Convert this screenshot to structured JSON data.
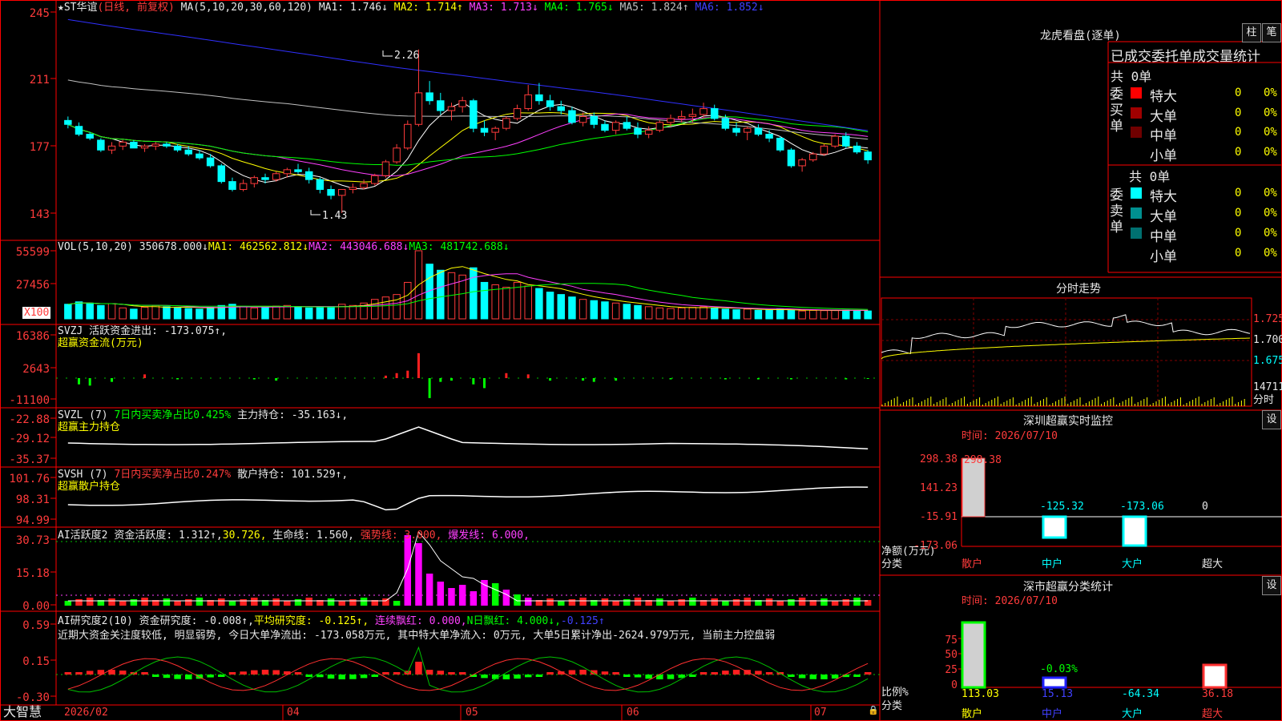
{
  "app_name": "大智慧",
  "colors": {
    "up": "#ff3b3b",
    "down": "#00ffff",
    "grid": "#c00000",
    "frame": "#ff0000"
  },
  "price_panel": {
    "stock_name": "★ST华谊",
    "period": "(日线, 前复权)",
    "ma_prefix": "MA(5,10,20,30,60,120)",
    "ma_values": [
      "MA1: 1.746↓",
      "MA2: 1.714↑",
      "MA3: 1.713↓",
      "MA4: 1.765↓",
      "MA5: 1.824↑",
      "MA6: 1.852↓"
    ],
    "y_ticks": [
      "245",
      "211",
      "177",
      "143"
    ],
    "high_label": "2.26",
    "low_label": "1.43"
  },
  "vol_panel": {
    "title": "VOL(5,10,20)",
    "value": "350678.000↓",
    "ma1": "MA1: 462562.812↓",
    "ma2": "MA2: 443046.688↓",
    "ma3": "MA3: 481742.688↓",
    "y_ticks": [
      "55599",
      "27456"
    ],
    "unit": "X100"
  },
  "svzj_panel": {
    "title": "SVZJ",
    "label": "活跃资金进出: -173.075↑,",
    "subtitle": "超赢资金流(万元)",
    "y_ticks": [
      "16386",
      "2643",
      "-11100"
    ]
  },
  "svzl_panel": {
    "title": "SVZL (7)",
    "ratio": "7日内买卖净占比0.425%",
    "label": "主力持仓: -35.163↓,",
    "subtitle": "超赢主力持仓",
    "y_ticks": [
      "-22.88",
      "-29.12",
      "-35.37"
    ]
  },
  "svsh_panel": {
    "title": "SVSH (7)",
    "ratio": "7日内买卖净占比0.247%",
    "label": "散户持仓: 101.529↑,",
    "subtitle": "超赢散户持仓",
    "y_ticks": [
      "101.76",
      "98.31",
      "94.99"
    ]
  },
  "ai_active_panel": {
    "title": "AI活跃度2",
    "label": "资金活跃度: 1.312↑,",
    "v2": "30.726,",
    "life": "生命线: 1.560,",
    "strong": "强势线: 3.000,",
    "burst": "爆发线: 6.000,",
    "y_ticks": [
      "30.73",
      "15.18",
      "0.00"
    ]
  },
  "ai_research_panel": {
    "title": "AI研究度2(10)",
    "label": "资金研究度: -0.008↑,",
    "avg": "平均研究度: -0.125↑,",
    "cont": "连续飘红: 0.000,",
    "nday": "N日飘红: 4.000↓,",
    "last": "-0.125↑",
    "comment": "近期大资金关注度较低, 明显弱势, 今日大单净流出: -173.058万元, 其中特大单净流入: 0万元, 大单5日累计净出-2624.979万元, 当前主力控盘弱",
    "y_ticks": [
      "0.59",
      "0.15",
      "-0.30"
    ]
  },
  "x_axis": [
    "2026/02",
    "04",
    "05",
    "06",
    "07"
  ],
  "order_panel": {
    "title": "龙虎看盘(逐单)",
    "btn_bar": "柱",
    "btn_pen": "笔",
    "subtitle": "已成交委托单成交量统计",
    "buy": {
      "label": "委买单",
      "total": "共 0单",
      "rows": [
        {
          "name": "特大",
          "count": "0",
          "pct": "0%",
          "color": "#ff0000"
        },
        {
          "name": "大单",
          "count": "0",
          "pct": "0%",
          "color": "#a00000"
        },
        {
          "name": "中单",
          "count": "0",
          "pct": "0%",
          "color": "#700000"
        },
        {
          "name": "小单",
          "count": "0",
          "pct": "0%",
          "color": "#000000"
        }
      ]
    },
    "sell": {
      "label": "委卖单",
      "total": "共 0单",
      "rows": [
        {
          "name": "特大",
          "count": "0",
          "pct": "0%",
          "color": "#00ffff"
        },
        {
          "name": "大单",
          "count": "0",
          "pct": "0%",
          "color": "#009090"
        },
        {
          "name": "中单",
          "count": "0",
          "pct": "0%",
          "color": "#007070"
        },
        {
          "name": "小单",
          "count": "0",
          "pct": "0%",
          "color": "#000000"
        }
      ]
    }
  },
  "intraday_panel": {
    "title": "分时走势",
    "y_ticks": [
      "1.725",
      "1.700",
      "1.675"
    ],
    "vol_label": "14711",
    "vol_unit": "分时"
  },
  "sz_monitor": {
    "title": "深圳超赢实时监控",
    "btn": "设",
    "time": "时间: 2026/07/10",
    "y_ticks": [
      "298.38",
      "141.23",
      "-15.91",
      "-173.06"
    ],
    "ylabel": "净额(万元)",
    "xlabel": "分类",
    "categories": [
      "散户",
      "中户",
      "大户",
      "超大"
    ],
    "value_labels": [
      "298.38",
      "-125.32",
      "-173.06",
      "0"
    ]
  },
  "sz_class": {
    "title": "深市超赢分类统计",
    "btn": "设",
    "time": "时间: 2026/07/10",
    "y_ticks": [
      "75",
      "50",
      "25",
      "0"
    ],
    "ylabel": "比例%",
    "xlabel": "分类",
    "categories": [
      "散户",
      "中户",
      "大户",
      "超大"
    ],
    "bar_pct_label": "-0.03%",
    "value_labels": [
      "113.03",
      "15.13",
      "-64.34",
      "36.18"
    ]
  },
  "chart_data": [
    {
      "type": "candlestick",
      "title": "★ST华谊 (日线, 前复权)",
      "ylim": [
        1.4,
        2.45
      ],
      "ohlc": [
        [
          1.9,
          1.92,
          1.86,
          1.88
        ],
        [
          1.87,
          1.89,
          1.82,
          1.83
        ],
        [
          1.83,
          1.84,
          1.8,
          1.81
        ],
        [
          1.8,
          1.81,
          1.74,
          1.75
        ],
        [
          1.75,
          1.79,
          1.73,
          1.77
        ],
        [
          1.77,
          1.8,
          1.75,
          1.79
        ],
        [
          1.79,
          1.8,
          1.76,
          1.76
        ],
        [
          1.76,
          1.78,
          1.74,
          1.77
        ],
        [
          1.77,
          1.79,
          1.75,
          1.78
        ],
        [
          1.78,
          1.79,
          1.76,
          1.77
        ],
        [
          1.77,
          1.78,
          1.74,
          1.75
        ],
        [
          1.75,
          1.77,
          1.72,
          1.73
        ],
        [
          1.73,
          1.75,
          1.7,
          1.71
        ],
        [
          1.71,
          1.73,
          1.66,
          1.67
        ],
        [
          1.67,
          1.68,
          1.58,
          1.59
        ],
        [
          1.59,
          1.61,
          1.54,
          1.55
        ],
        [
          1.55,
          1.6,
          1.54,
          1.58
        ],
        [
          1.58,
          1.62,
          1.56,
          1.61
        ],
        [
          1.61,
          1.63,
          1.58,
          1.6
        ],
        [
          1.6,
          1.64,
          1.59,
          1.63
        ],
        [
          1.63,
          1.66,
          1.61,
          1.65
        ],
        [
          1.65,
          1.68,
          1.63,
          1.64
        ],
        [
          1.64,
          1.66,
          1.58,
          1.6
        ],
        [
          1.6,
          1.61,
          1.53,
          1.55
        ],
        [
          1.55,
          1.57,
          1.5,
          1.52
        ],
        [
          1.52,
          1.54,
          1.43,
          1.55
        ],
        [
          1.55,
          1.58,
          1.53,
          1.56
        ],
        [
          1.56,
          1.6,
          1.55,
          1.58
        ],
        [
          1.58,
          1.63,
          1.57,
          1.62
        ],
        [
          1.62,
          1.7,
          1.61,
          1.69
        ],
        [
          1.69,
          1.78,
          1.68,
          1.76
        ],
        [
          1.76,
          1.9,
          1.75,
          1.88
        ],
        [
          1.88,
          2.26,
          1.87,
          2.04
        ],
        [
          2.04,
          2.1,
          1.98,
          2.0
        ],
        [
          2.0,
          2.04,
          1.93,
          1.95
        ],
        [
          1.95,
          1.99,
          1.9,
          1.97
        ],
        [
          1.97,
          2.02,
          1.94,
          2.0
        ],
        [
          2.0,
          2.01,
          1.84,
          1.86
        ],
        [
          1.86,
          1.9,
          1.82,
          1.84
        ],
        [
          1.84,
          1.87,
          1.8,
          1.86
        ],
        [
          1.86,
          1.92,
          1.85,
          1.91
        ],
        [
          1.91,
          1.98,
          1.9,
          1.96
        ],
        [
          1.96,
          2.08,
          1.95,
          2.03
        ],
        [
          2.03,
          2.09,
          1.98,
          2.0
        ],
        [
          2.0,
          2.03,
          1.95,
          1.97
        ],
        [
          1.97,
          2.0,
          1.93,
          1.95
        ],
        [
          1.95,
          1.97,
          1.88,
          1.89
        ],
        [
          1.89,
          1.94,
          1.87,
          1.92
        ],
        [
          1.92,
          1.94,
          1.86,
          1.88
        ],
        [
          1.88,
          1.9,
          1.84,
          1.85
        ],
        [
          1.85,
          1.9,
          1.83,
          1.89
        ],
        [
          1.89,
          1.92,
          1.85,
          1.86
        ],
        [
          1.86,
          1.89,
          1.81,
          1.83
        ],
        [
          1.83,
          1.87,
          1.81,
          1.85
        ],
        [
          1.85,
          1.9,
          1.84,
          1.89
        ],
        [
          1.89,
          1.93,
          1.87,
          1.91
        ],
        [
          1.91,
          1.95,
          1.89,
          1.92
        ],
        [
          1.92,
          1.96,
          1.89,
          1.93
        ],
        [
          1.93,
          1.99,
          1.91,
          1.96
        ],
        [
          1.96,
          1.98,
          1.9,
          1.91
        ],
        [
          1.91,
          1.93,
          1.85,
          1.86
        ],
        [
          1.86,
          1.89,
          1.82,
          1.84
        ],
        [
          1.84,
          1.87,
          1.8,
          1.86
        ],
        [
          1.86,
          1.88,
          1.82,
          1.83
        ],
        [
          1.83,
          1.85,
          1.79,
          1.81
        ],
        [
          1.81,
          1.82,
          1.74,
          1.75
        ],
        [
          1.75,
          1.76,
          1.66,
          1.67
        ],
        [
          1.67,
          1.71,
          1.64,
          1.7
        ],
        [
          1.7,
          1.74,
          1.69,
          1.73
        ],
        [
          1.73,
          1.78,
          1.72,
          1.77
        ],
        [
          1.77,
          1.83,
          1.76,
          1.82
        ],
        [
          1.82,
          1.84,
          1.76,
          1.77
        ],
        [
          1.77,
          1.79,
          1.73,
          1.74
        ],
        [
          1.74,
          1.75,
          1.68,
          1.7
        ]
      ],
      "ma_series": [
        {
          "name": "MA1",
          "color": "#ffffff",
          "last": 1.746
        },
        {
          "name": "MA2",
          "color": "#ffff00",
          "last": 1.714
        },
        {
          "name": "MA3",
          "color": "#ff40ff",
          "last": 1.713
        },
        {
          "name": "MA4",
          "color": "#00ff00",
          "last": 1.765
        },
        {
          "name": "MA5",
          "color": "#c0c0c0",
          "last": 1.824
        },
        {
          "name": "MA6",
          "color": "#3030ff",
          "last": 1.852
        }
      ],
      "annotations": [
        {
          "label": "2.26",
          "value": 2.26
        },
        {
          "label": "1.43",
          "value": 1.43
        }
      ]
    },
    {
      "type": "bar",
      "title": "VOL(5,10,20)",
      "unit": "X100",
      "ylim": [
        0,
        55599
      ],
      "values": [
        12000,
        14000,
        13000,
        11000,
        12500,
        9000,
        8000,
        9500,
        11000,
        10000,
        9000,
        8500,
        8000,
        9500,
        11000,
        12000,
        10000,
        9000,
        9500,
        10500,
        11000,
        10000,
        9000,
        9500,
        10000,
        12000,
        11000,
        13000,
        16000,
        18000,
        20000,
        30000,
        56000,
        45000,
        40000,
        38000,
        36000,
        42000,
        30000,
        28000,
        26000,
        30000,
        27000,
        25000,
        22000,
        20000,
        18000,
        16000,
        15000,
        14000,
        13000,
        12000,
        11000,
        10000,
        9000,
        8500,
        9000,
        9500,
        10000,
        9000,
        8000,
        7500,
        8000,
        7000,
        7500,
        8000,
        7000,
        6500,
        7000,
        6800,
        7000,
        7200,
        6900,
        6500
      ],
      "series": [
        {
          "name": "MA1",
          "value": 462562.812
        },
        {
          "name": "MA2",
          "value": 443046.688
        },
        {
          "name": "MA3",
          "value": 481742.688
        }
      ]
    },
    {
      "type": "bar",
      "title": "SVZJ 活跃资金进出",
      "ylim": [
        -11100,
        16386
      ],
      "values": [
        0,
        -2500,
        -3000,
        0,
        -1500,
        0,
        0,
        1500,
        0,
        0,
        -500,
        0,
        0,
        0,
        0,
        0,
        0,
        -500,
        0,
        -1000,
        0,
        0,
        0,
        0,
        0,
        0,
        0,
        0,
        0,
        1000,
        2000,
        3000,
        10000,
        -8000,
        -1500,
        -1000,
        0,
        -2500,
        -4000,
        0,
        2000,
        0,
        1500,
        0,
        -1000,
        0,
        0,
        -1000,
        -1500,
        0,
        -1000,
        0,
        0,
        0,
        0,
        -500,
        0,
        0,
        0,
        0,
        -500,
        0,
        0,
        -500,
        0,
        0,
        -500,
        0,
        0,
        0,
        0,
        -500,
        0,
        -173
      ]
    }
  ]
}
